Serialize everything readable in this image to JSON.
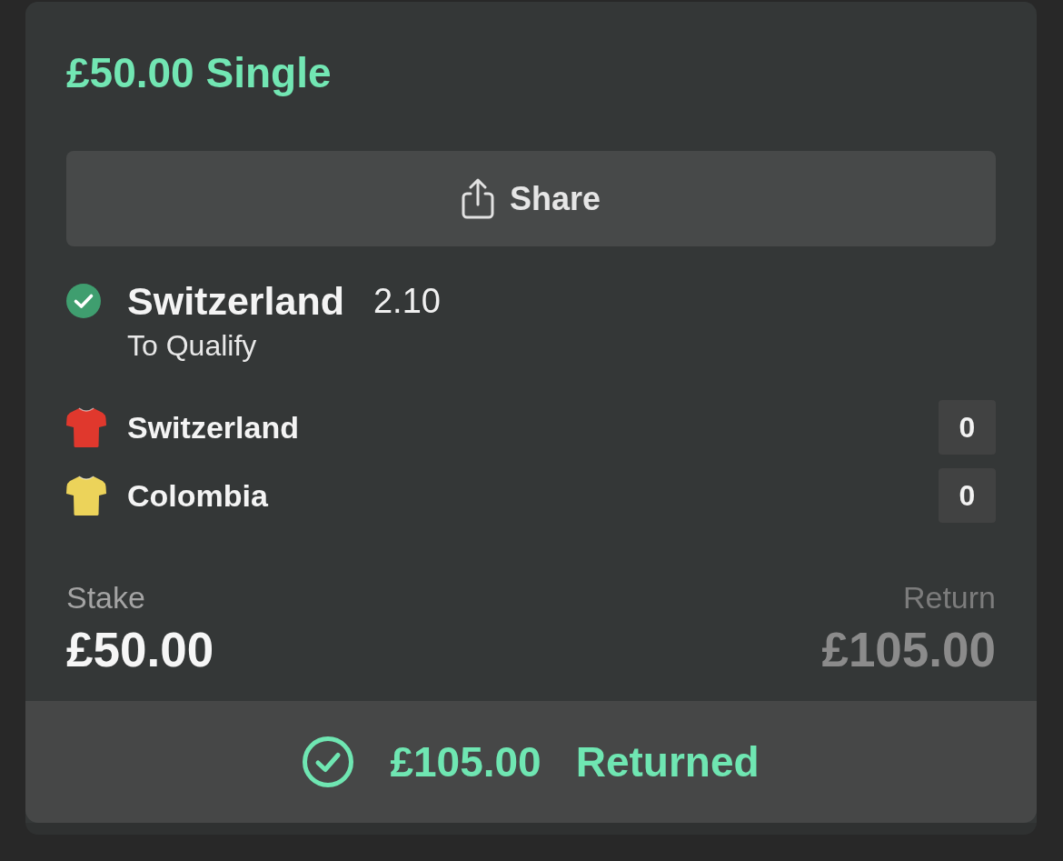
{
  "bet": {
    "title": "£50.00 Single"
  },
  "share_button": {
    "label": "Share"
  },
  "selection": {
    "won": true,
    "name": "Switzerland",
    "odds": "2.10",
    "market": "To Qualify"
  },
  "teams": [
    {
      "name": "Switzerland",
      "color": "#e0382d",
      "score": "0"
    },
    {
      "name": "Colombia",
      "color": "#ecd35a",
      "score": "0"
    }
  ],
  "stake": {
    "label": "Stake",
    "value": "£50.00"
  },
  "potential_return": {
    "label": "Return",
    "value": "£105.00"
  },
  "result": {
    "amount": "£105.00",
    "status": "Returned"
  }
}
